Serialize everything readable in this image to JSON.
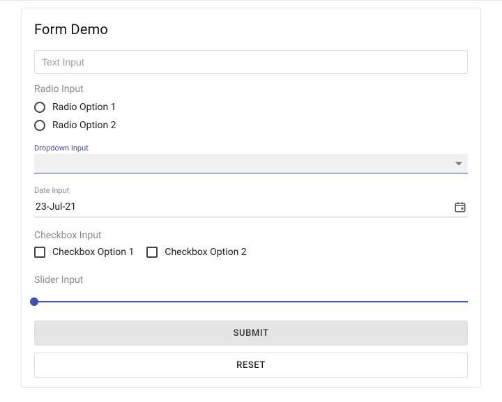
{
  "title": "Form Demo",
  "textInput": {
    "placeholder": "Text Input",
    "value": ""
  },
  "radio": {
    "label": "Radio Input",
    "options": [
      "Radio Option 1",
      "Radio Option 2"
    ]
  },
  "dropdown": {
    "label": "Dropdown Input",
    "selected": ""
  },
  "date": {
    "label": "Date Input",
    "value": "23-Jul-21"
  },
  "checkbox": {
    "label": "Checkbox Input",
    "options": [
      "Checkbox Option 1",
      "Checkbox Option 2"
    ]
  },
  "slider": {
    "label": "Slider Input",
    "value": 0
  },
  "buttons": {
    "submit": "SUBMIT",
    "reset": "RESET"
  }
}
